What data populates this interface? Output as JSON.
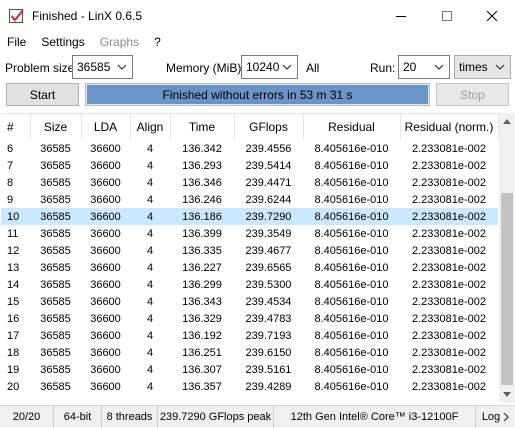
{
  "window": {
    "title": "Finished - LinX 0.6.5"
  },
  "menu": {
    "items": [
      {
        "label": "File",
        "enabled": true
      },
      {
        "label": "Settings",
        "enabled": true
      },
      {
        "label": "Graphs",
        "enabled": false
      },
      {
        "label": "?",
        "enabled": true
      }
    ]
  },
  "settings": {
    "problem_size_label": "Problem size:",
    "problem_size_value": "36585",
    "memory_label": "Memory (MiB):",
    "memory_value": "10240",
    "all_label": "All",
    "run_label": "Run:",
    "run_value": "20",
    "run_unit": "times"
  },
  "controls": {
    "start_label": "Start",
    "stop_label": "Stop",
    "progress_text": "Finished without errors in 53 m 31 s",
    "progress_fraction": 1.0
  },
  "table": {
    "columns": [
      "#",
      "Size",
      "LDA",
      "Align",
      "Time",
      "GFlops",
      "Residual",
      "Residual (norm.)"
    ],
    "selected_run": "10",
    "rows": [
      [
        "6",
        "36585",
        "36600",
        "4",
        "136.342",
        "239.4556",
        "8.405616e-010",
        "2.233081e-002"
      ],
      [
        "7",
        "36585",
        "36600",
        "4",
        "136.293",
        "239.5414",
        "8.405616e-010",
        "2.233081e-002"
      ],
      [
        "8",
        "36585",
        "36600",
        "4",
        "136.346",
        "239.4471",
        "8.405616e-010",
        "2.233081e-002"
      ],
      [
        "9",
        "36585",
        "36600",
        "4",
        "136.246",
        "239.6244",
        "8.405616e-010",
        "2.233081e-002"
      ],
      [
        "10",
        "36585",
        "36600",
        "4",
        "136.186",
        "239.7290",
        "8.405616e-010",
        "2.233081e-002"
      ],
      [
        "11",
        "36585",
        "36600",
        "4",
        "136.399",
        "239.3549",
        "8.405616e-010",
        "2.233081e-002"
      ],
      [
        "12",
        "36585",
        "36600",
        "4",
        "136.335",
        "239.4677",
        "8.405616e-010",
        "2.233081e-002"
      ],
      [
        "13",
        "36585",
        "36600",
        "4",
        "136.227",
        "239.6565",
        "8.405616e-010",
        "2.233081e-002"
      ],
      [
        "14",
        "36585",
        "36600",
        "4",
        "136.299",
        "239.5300",
        "8.405616e-010",
        "2.233081e-002"
      ],
      [
        "15",
        "36585",
        "36600",
        "4",
        "136.343",
        "239.4534",
        "8.405616e-010",
        "2.233081e-002"
      ],
      [
        "16",
        "36585",
        "36600",
        "4",
        "136.329",
        "239.4783",
        "8.405616e-010",
        "2.233081e-002"
      ],
      [
        "17",
        "36585",
        "36600",
        "4",
        "136.192",
        "239.7193",
        "8.405616e-010",
        "2.233081e-002"
      ],
      [
        "18",
        "36585",
        "36600",
        "4",
        "136.251",
        "239.6150",
        "8.405616e-010",
        "2.233081e-002"
      ],
      [
        "19",
        "36585",
        "36600",
        "4",
        "136.307",
        "239.5161",
        "8.405616e-010",
        "2.233081e-002"
      ],
      [
        "20",
        "36585",
        "36600",
        "4",
        "136.357",
        "239.4289",
        "8.405616e-010",
        "2.233081e-002"
      ]
    ]
  },
  "status": {
    "runs": "20/20",
    "arch": "64-bit",
    "threads": "8 threads",
    "peak": "239.7290 GFlops peak",
    "cpu": "12th Gen Intel® Core™ i3-12100F",
    "log": "Log"
  },
  "colors": {
    "progress_fill": "#6a93c8",
    "selected_row": "#cce8ff",
    "icon_red": "#d13438"
  },
  "icons": {
    "app": "checkbox-check-icon",
    "minimize": "minimize-icon",
    "maximize": "maximize-icon",
    "close": "close-icon",
    "dropdown": "chevron-down-icon",
    "scroll_up": "scroll-up-arrow-icon",
    "scroll_down": "scroll-down-arrow-icon",
    "log": "chevron-right-icon"
  }
}
